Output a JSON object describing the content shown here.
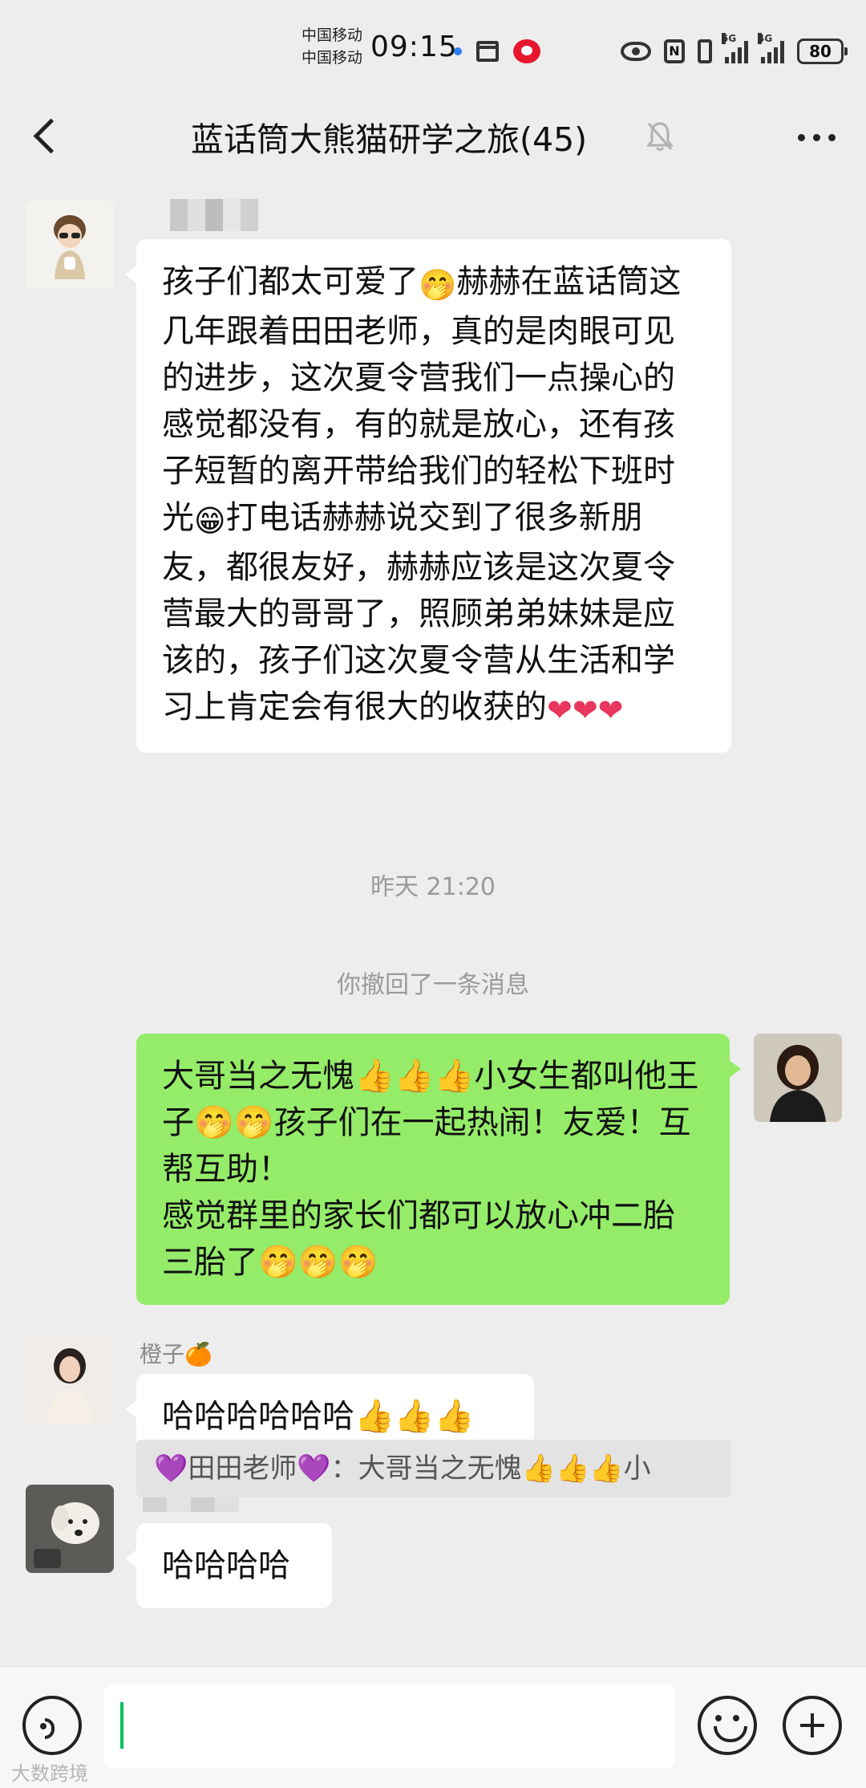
{
  "status_bar": {
    "carrier_1": "中国移动",
    "carrier_2": "中国移动",
    "time": "09:15",
    "network_1": "5G",
    "network_2": "4G",
    "battery": "80"
  },
  "header": {
    "title": "蓝话筒大熊猫研学之旅(45)",
    "icons": [
      "back-icon",
      "mute-bell-icon",
      "more-icon"
    ]
  },
  "messages": {
    "msg1": {
      "sender": "",
      "text_a": "孩子们都太可爱了",
      "emoji_a": "🤭",
      "text_b": "赫赫在蓝话筒这几年跟着田田老师，真的是肉眼可见的进步，这次夏令营我们一点操心的感觉都没有，有的就是放心，还有孩子短暂的离开带给我们的轻松下班时光",
      "emoji_b": "😁",
      "text_c": "打电话赫赫说交到了很多新朋友，都很友好，赫赫应该是这次夏令营最大的哥哥了，照顾弟弟妹妹是应该的，孩子们这次夏令营从生活和学习上肯定会有很大的收获的",
      "hearts": "❤❤❤"
    },
    "timestamp": "昨天 21:20",
    "recall_notice": "你撤回了一条消息",
    "msg2": {
      "line1": "大哥当之无愧👍👍👍小女生都叫他王子🤭🤭孩子们在一起热闹！友爱！互帮互助！",
      "line2": "感觉群里的家长们都可以放心冲二胎三胎了🤭🤭🤭"
    },
    "msg3": {
      "sender": "橙子🍊",
      "text": "哈哈哈哈哈哈👍👍👍"
    },
    "msg4": {
      "sender": "",
      "text": "哈哈哈哈"
    },
    "quote": "💜田田老师💜：大哥当之无愧👍👍👍小"
  },
  "input": {
    "value": ""
  },
  "watermark": "大数跨境",
  "colors": {
    "background": "#ededed",
    "self_bubble": "#95ec69",
    "other_bubble": "#ffffff",
    "caret": "#07c160"
  }
}
